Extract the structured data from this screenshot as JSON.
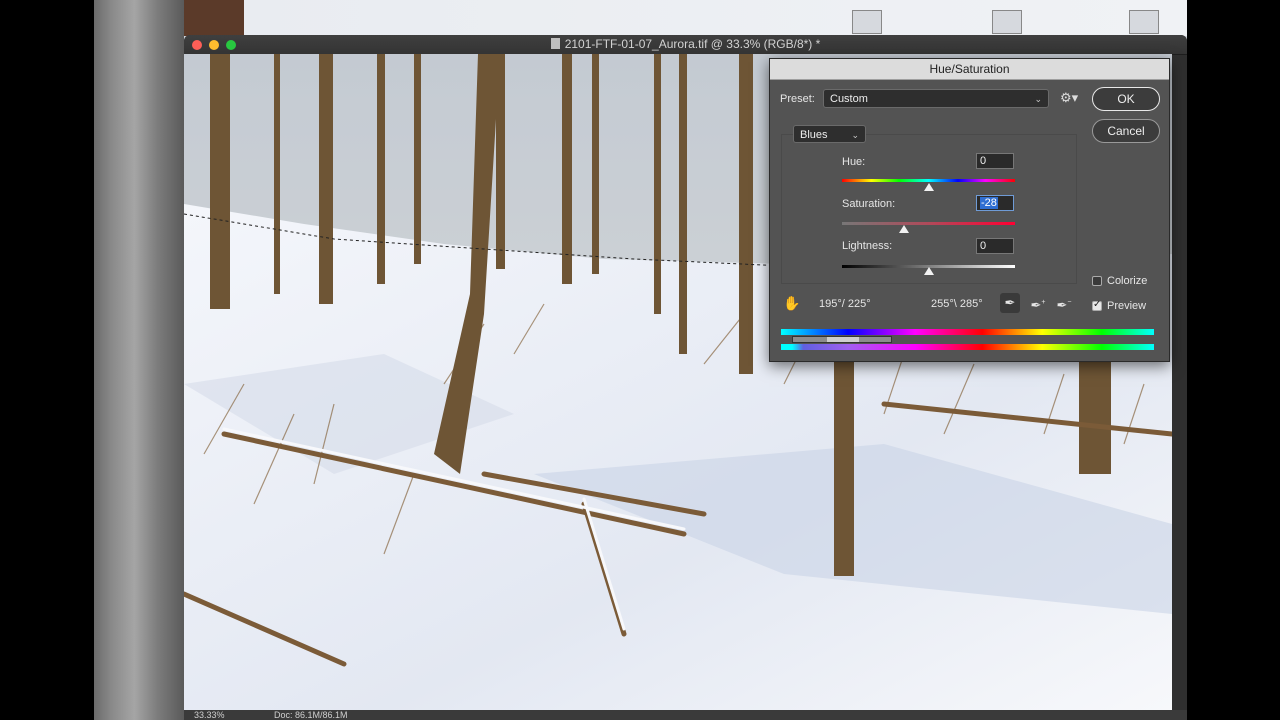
{
  "document": {
    "title": "2101-FTF-01-07_Aurora.tif @ 33.3% (RGB/8*) *",
    "status_zoom": "33.33%",
    "status_doc": "Doc: 86.1M/86.1M"
  },
  "dialog": {
    "title": "Hue/Saturation",
    "preset_label": "Preset:",
    "preset_value": "Custom",
    "ok_label": "OK",
    "cancel_label": "Cancel",
    "channel_value": "Blues",
    "hue": {
      "label": "Hue:",
      "value": "0",
      "level": 0.5
    },
    "saturation": {
      "label": "Saturation:",
      "value": "-28",
      "level": 0.36
    },
    "lightness": {
      "label": "Lightness:",
      "value": "0",
      "level": 0.5
    },
    "range_left": "195°/ 225°",
    "range_right": "255°\\ 285°",
    "colorize_label": "Colorize",
    "colorize_checked": false,
    "preview_label": "Preview",
    "preview_checked": true
  },
  "icons": {
    "gear": "gear-icon",
    "hand": "hand-icon",
    "eyedropper": "eyedropper-icon",
    "eyedropper_plus": "eyedropper-plus-icon",
    "eyedropper_minus": "eyedropper-minus-icon"
  },
  "colors": {
    "traffic_close": "#fe5f57",
    "traffic_min": "#febc2e",
    "traffic_max": "#28c840",
    "selection_highlight": "#2f6ed2"
  }
}
